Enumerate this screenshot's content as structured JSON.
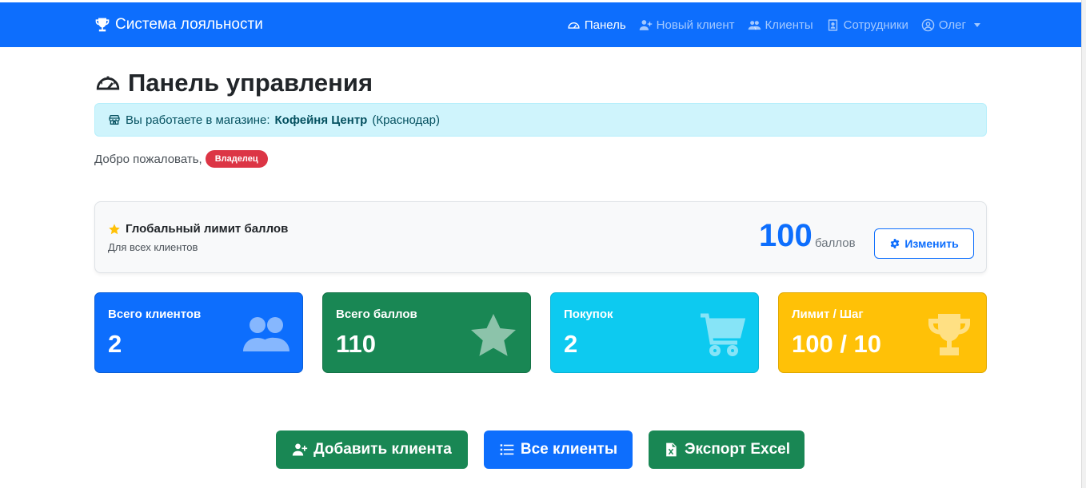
{
  "navbar": {
    "brand": "Система лояльности",
    "links": [
      {
        "label": "Панель",
        "icon": "gauge-icon",
        "active": true
      },
      {
        "label": "Новый клиент",
        "icon": "user-plus-icon",
        "active": false
      },
      {
        "label": "Клиенты",
        "icon": "users-icon",
        "active": false
      },
      {
        "label": "Сотрудники",
        "icon": "id-badge-icon",
        "active": false
      }
    ],
    "user": {
      "label": "Олег",
      "icon": "user-circle-icon"
    }
  },
  "header": {
    "title": "Панель управления",
    "icon": "gauge-icon"
  },
  "store_alert": {
    "prefix": "Вы работаете в магазине:",
    "store_name": "Кофейня Центр",
    "city": "(Краснодар)",
    "icon": "store-icon"
  },
  "welcome": {
    "text": "Добро пожаловать,",
    "role_badge": "Владелец"
  },
  "limit_card": {
    "title": "Глобальный лимит баллов",
    "subtitle": "Для всех клиентов",
    "value": "100",
    "unit": "баллов",
    "button": "Изменить"
  },
  "stats": [
    {
      "label": "Всего клиентов",
      "value": "2",
      "icon": "users-icon",
      "color": "#0d6efd"
    },
    {
      "label": "Всего баллов",
      "value": "110",
      "icon": "star-icon",
      "color": "#198754"
    },
    {
      "label": "Покупок",
      "value": "2",
      "icon": "cart-icon",
      "color": "#0dcaf0"
    },
    {
      "label": "Лимит / Шаг",
      "value": "100 / 10",
      "icon": "trophy-icon",
      "color": "#ffc107"
    }
  ],
  "actions": {
    "add_client": "Добавить клиента",
    "all_clients": "Все клиенты",
    "export_excel": "Экспорт Excel"
  },
  "colors": {
    "primary": "#0d6efd",
    "success": "#198754",
    "info": "#0dcaf0",
    "warning": "#ffc107",
    "danger": "#dc3545"
  }
}
